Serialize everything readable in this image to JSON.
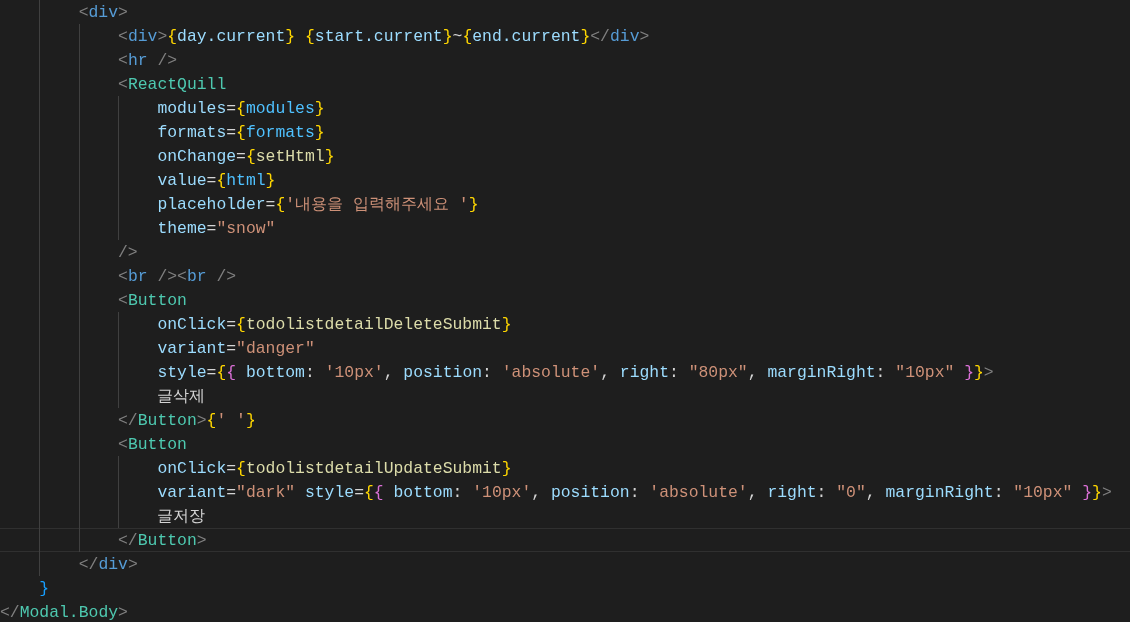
{
  "editor": {
    "lines": [
      {
        "active": false,
        "tokens": [
          {
            "kind": "bracket",
            "text": "        <"
          },
          {
            "kind": "tag",
            "text": "div"
          },
          {
            "kind": "bracket",
            "text": ">"
          }
        ]
      },
      {
        "active": false,
        "tokens": [
          {
            "kind": "bracket",
            "text": "            <"
          },
          {
            "kind": "tag",
            "text": "div"
          },
          {
            "kind": "bracket",
            "text": ">"
          },
          {
            "kind": "brace",
            "text": "{"
          },
          {
            "kind": "var",
            "text": "day.current"
          },
          {
            "kind": "brace",
            "text": "}"
          },
          {
            "kind": "brace",
            "text": " {"
          },
          {
            "kind": "var",
            "text": "start.current"
          },
          {
            "kind": "brace",
            "text": "}"
          },
          {
            "kind": "plain",
            "text": "~"
          },
          {
            "kind": "brace",
            "text": "{"
          },
          {
            "kind": "var",
            "text": "end.current"
          },
          {
            "kind": "brace",
            "text": "}"
          },
          {
            "kind": "bracket",
            "text": "</"
          },
          {
            "kind": "tag",
            "text": "div"
          },
          {
            "kind": "bracket",
            "text": ">"
          }
        ]
      },
      {
        "active": false,
        "tokens": [
          {
            "kind": "bracket",
            "text": "            <"
          },
          {
            "kind": "tag",
            "text": "hr"
          },
          {
            "kind": "bracket",
            "text": " />"
          }
        ]
      },
      {
        "active": false,
        "tokens": [
          {
            "kind": "bracket",
            "text": "            <"
          },
          {
            "kind": "component",
            "text": "ReactQuill"
          }
        ]
      },
      {
        "active": false,
        "tokens": [
          {
            "kind": "attr",
            "text": "                modules"
          },
          {
            "kind": "plain",
            "text": "="
          },
          {
            "kind": "brace",
            "text": "{"
          },
          {
            "kind": "const",
            "text": "modules"
          },
          {
            "kind": "brace",
            "text": "}"
          }
        ]
      },
      {
        "active": false,
        "tokens": [
          {
            "kind": "attr",
            "text": "                formats"
          },
          {
            "kind": "plain",
            "text": "="
          },
          {
            "kind": "brace",
            "text": "{"
          },
          {
            "kind": "const",
            "text": "formats"
          },
          {
            "kind": "brace",
            "text": "}"
          }
        ]
      },
      {
        "active": false,
        "tokens": [
          {
            "kind": "attr",
            "text": "                onChange"
          },
          {
            "kind": "plain",
            "text": "="
          },
          {
            "kind": "brace",
            "text": "{"
          },
          {
            "kind": "func",
            "text": "setHtml"
          },
          {
            "kind": "brace",
            "text": "}"
          }
        ]
      },
      {
        "active": false,
        "tokens": [
          {
            "kind": "attr",
            "text": "                value"
          },
          {
            "kind": "plain",
            "text": "="
          },
          {
            "kind": "brace",
            "text": "{"
          },
          {
            "kind": "const",
            "text": "html"
          },
          {
            "kind": "brace",
            "text": "}"
          }
        ]
      },
      {
        "active": false,
        "tokens": [
          {
            "kind": "attr",
            "text": "                placeholder"
          },
          {
            "kind": "plain",
            "text": "="
          },
          {
            "kind": "brace",
            "text": "{"
          },
          {
            "kind": "string",
            "text": "'내용을 입력해주세요 '"
          },
          {
            "kind": "brace",
            "text": "}"
          }
        ]
      },
      {
        "active": false,
        "tokens": [
          {
            "kind": "attr",
            "text": "                theme"
          },
          {
            "kind": "plain",
            "text": "="
          },
          {
            "kind": "string",
            "text": "\"snow\""
          }
        ]
      },
      {
        "active": false,
        "tokens": [
          {
            "kind": "bracket",
            "text": "            />"
          }
        ]
      },
      {
        "active": false,
        "tokens": [
          {
            "kind": "bracket",
            "text": "            <"
          },
          {
            "kind": "tag",
            "text": "br"
          },
          {
            "kind": "bracket",
            "text": " /><"
          },
          {
            "kind": "tag",
            "text": "br"
          },
          {
            "kind": "bracket",
            "text": " />"
          }
        ]
      },
      {
        "active": false,
        "tokens": [
          {
            "kind": "bracket",
            "text": "            <"
          },
          {
            "kind": "component",
            "text": "Button"
          }
        ]
      },
      {
        "active": false,
        "tokens": [
          {
            "kind": "attr",
            "text": "                onClick"
          },
          {
            "kind": "plain",
            "text": "="
          },
          {
            "kind": "brace",
            "text": "{"
          },
          {
            "kind": "func",
            "text": "todolistdetailDeleteSubmit"
          },
          {
            "kind": "brace",
            "text": "}"
          }
        ]
      },
      {
        "active": false,
        "tokens": [
          {
            "kind": "attr",
            "text": "                variant"
          },
          {
            "kind": "plain",
            "text": "="
          },
          {
            "kind": "string",
            "text": "\"danger\""
          }
        ]
      },
      {
        "active": false,
        "tokens": [
          {
            "kind": "attr",
            "text": "                style"
          },
          {
            "kind": "plain",
            "text": "="
          },
          {
            "kind": "brace",
            "text": "{"
          },
          {
            "kind": "brace2",
            "text": "{"
          },
          {
            "kind": "var",
            "text": " bottom"
          },
          {
            "kind": "plain",
            "text": ": "
          },
          {
            "kind": "string",
            "text": "'10px'"
          },
          {
            "kind": "plain",
            "text": ", "
          },
          {
            "kind": "var",
            "text": "position"
          },
          {
            "kind": "plain",
            "text": ": "
          },
          {
            "kind": "string",
            "text": "'absolute'"
          },
          {
            "kind": "plain",
            "text": ", "
          },
          {
            "kind": "var",
            "text": "right"
          },
          {
            "kind": "plain",
            "text": ": "
          },
          {
            "kind": "string",
            "text": "\"80px\""
          },
          {
            "kind": "plain",
            "text": ", "
          },
          {
            "kind": "var",
            "text": "marginRight"
          },
          {
            "kind": "plain",
            "text": ": "
          },
          {
            "kind": "string",
            "text": "\"10px\" "
          },
          {
            "kind": "brace2",
            "text": "}"
          },
          {
            "kind": "brace",
            "text": "}"
          },
          {
            "kind": "bracket",
            "text": ">"
          }
        ]
      },
      {
        "active": false,
        "tokens": [
          {
            "kind": "plain",
            "text": "                글삭제"
          }
        ]
      },
      {
        "active": false,
        "tokens": [
          {
            "kind": "bracket",
            "text": "            </"
          },
          {
            "kind": "component",
            "text": "Button"
          },
          {
            "kind": "bracket",
            "text": ">"
          },
          {
            "kind": "brace",
            "text": "{"
          },
          {
            "kind": "string",
            "text": "' '"
          },
          {
            "kind": "brace",
            "text": "}"
          }
        ]
      },
      {
        "active": false,
        "tokens": [
          {
            "kind": "bracket",
            "text": "            <"
          },
          {
            "kind": "component",
            "text": "Button"
          }
        ]
      },
      {
        "active": false,
        "tokens": [
          {
            "kind": "attr",
            "text": "                onClick"
          },
          {
            "kind": "plain",
            "text": "="
          },
          {
            "kind": "brace",
            "text": "{"
          },
          {
            "kind": "func",
            "text": "todolistdetailUpdateSubmit"
          },
          {
            "kind": "brace",
            "text": "}"
          }
        ]
      },
      {
        "active": false,
        "tokens": [
          {
            "kind": "attr",
            "text": "                variant"
          },
          {
            "kind": "plain",
            "text": "="
          },
          {
            "kind": "string",
            "text": "\"dark\" "
          },
          {
            "kind": "attr",
            "text": "style"
          },
          {
            "kind": "plain",
            "text": "="
          },
          {
            "kind": "brace",
            "text": "{"
          },
          {
            "kind": "brace2",
            "text": "{"
          },
          {
            "kind": "var",
            "text": " bottom"
          },
          {
            "kind": "plain",
            "text": ": "
          },
          {
            "kind": "string",
            "text": "'10px'"
          },
          {
            "kind": "plain",
            "text": ", "
          },
          {
            "kind": "var",
            "text": "position"
          },
          {
            "kind": "plain",
            "text": ": "
          },
          {
            "kind": "string",
            "text": "'absolute'"
          },
          {
            "kind": "plain",
            "text": ", "
          },
          {
            "kind": "var",
            "text": "right"
          },
          {
            "kind": "plain",
            "text": ": "
          },
          {
            "kind": "string",
            "text": "\"0\""
          },
          {
            "kind": "plain",
            "text": ", "
          },
          {
            "kind": "var",
            "text": "marginRight"
          },
          {
            "kind": "plain",
            "text": ": "
          },
          {
            "kind": "string",
            "text": "\"10px\" "
          },
          {
            "kind": "brace2",
            "text": "}"
          },
          {
            "kind": "brace",
            "text": "}"
          },
          {
            "kind": "bracket",
            "text": ">"
          }
        ]
      },
      {
        "active": false,
        "tokens": [
          {
            "kind": "plain",
            "text": "                글저장"
          }
        ]
      },
      {
        "active": true,
        "tokens": [
          {
            "kind": "bracket",
            "text": "            </"
          },
          {
            "kind": "component",
            "text": "Button"
          },
          {
            "kind": "bracket",
            "text": ">"
          }
        ]
      },
      {
        "active": false,
        "tokens": [
          {
            "kind": "bracket",
            "text": "        </"
          },
          {
            "kind": "tag",
            "text": "div"
          },
          {
            "kind": "bracket",
            "text": ">"
          }
        ]
      },
      {
        "active": false,
        "tokens": [
          {
            "kind": "brace3",
            "text": "    }"
          }
        ]
      },
      {
        "active": false,
        "tokens": [
          {
            "kind": "bracket",
            "text": "</"
          },
          {
            "kind": "component",
            "text": "Modal.Body"
          },
          {
            "kind": "bracket",
            "text": ">"
          }
        ]
      }
    ]
  }
}
